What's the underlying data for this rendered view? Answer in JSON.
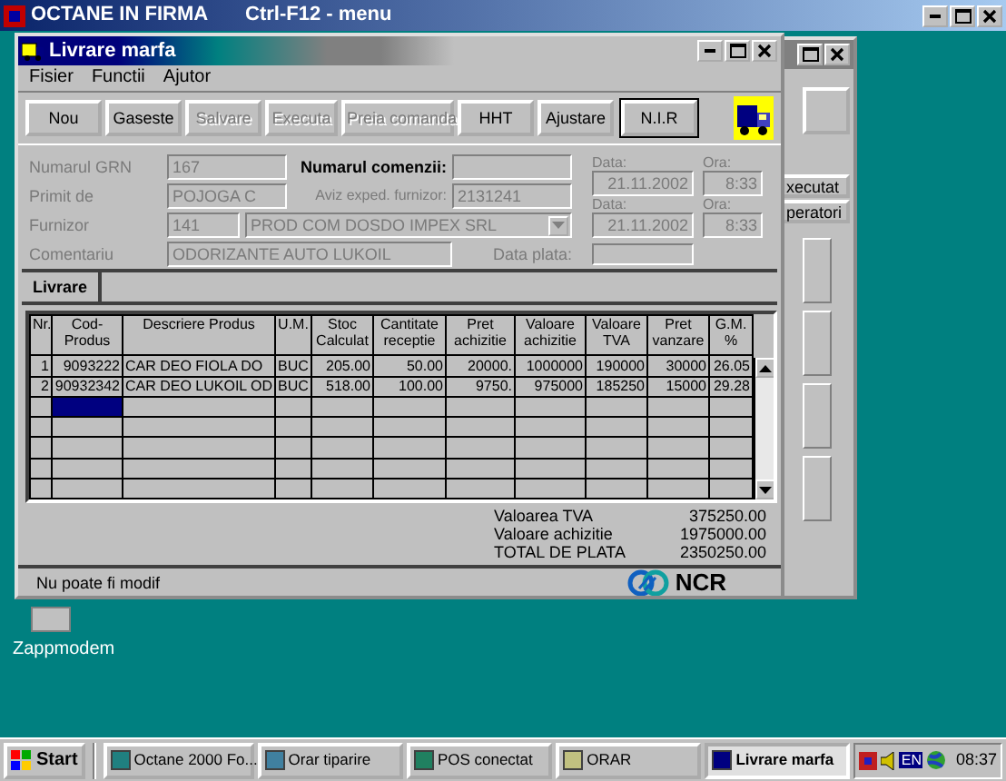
{
  "app_window": {
    "title": "OCTANE IN FIRMA",
    "hint": "Ctrl-F12 - menu"
  },
  "back_window": {
    "buttons": [
      "xecutat",
      "peratori"
    ]
  },
  "window": {
    "title": "Livrare marfa",
    "menu": [
      "Fisier",
      "Functii",
      "Ajutor"
    ],
    "toolbar": [
      {
        "label": "Nou",
        "disabled": false,
        "default": false
      },
      {
        "label": "Gaseste",
        "disabled": false,
        "default": false
      },
      {
        "label": "Salvare",
        "disabled": true,
        "default": false
      },
      {
        "label": "Executa",
        "disabled": true,
        "default": false
      },
      {
        "label": "Preia comanda",
        "disabled": true,
        "default": false
      },
      {
        "label": "HHT",
        "disabled": false,
        "default": false
      },
      {
        "label": "Ajustare",
        "disabled": false,
        "default": false
      },
      {
        "label": "N.I.R",
        "disabled": false,
        "default": true
      }
    ],
    "form": {
      "grn": {
        "label": "Numarul GRN",
        "value": "167",
        "disabled": true
      },
      "primit": {
        "label": "Primit de",
        "value": "POJOGA C",
        "disabled": true
      },
      "furnizor": {
        "label": "Furnizor",
        "code": "141",
        "name": "PROD COM DOSDO IMPEX SRL",
        "disabled": true
      },
      "comentariu": {
        "label": "Comentariu",
        "value": "ODORIZANTE AUTO LUKOIL",
        "disabled": true
      },
      "comanda": {
        "label": "Numarul comenzii:",
        "disabled": false
      },
      "aviz": {
        "label": "Aviz exped. furnizor:",
        "value": "2131241",
        "disabled": true
      },
      "dates": [
        {
          "date_label": "Data:",
          "date": "21.11.2002",
          "time_label": "Ora:",
          "time": "8:33"
        },
        {
          "date_label": "Data:",
          "date": "21.11.2002",
          "time_label": "Ora:",
          "time": "8:33"
        }
      ],
      "data_plata": {
        "label": "Data plata:",
        "disabled": true
      }
    },
    "tabs": [
      {
        "label": "Livrare",
        "selected": true
      }
    ],
    "table": {
      "columns": [
        "Nr.",
        "Cod-Produs",
        "Descriere Produs",
        "U.M.",
        "Stoc Calculat",
        "Cantitate receptie",
        "Pret achizitie",
        "Valoare achizitie",
        "Valoare TVA",
        "Pret vanzare",
        "G.M. %"
      ],
      "rows": [
        [
          "1",
          "9093222",
          "CAR DEO FIOLA DO",
          "BUC",
          "205.00",
          "50.00",
          "20000.",
          "1000000",
          "190000",
          "30000",
          "26.05"
        ],
        [
          "2",
          "90932342",
          "CAR DEO LUKOIL OD",
          "BUC",
          "518.00",
          "100.00",
          "9750.",
          "975000",
          "185250",
          "15000",
          "29.28"
        ]
      ],
      "cursor_on_new_row": true
    },
    "totals": [
      {
        "label": "Valoarea TVA",
        "value": "375250.00"
      },
      {
        "label": "Valoare achizitie",
        "value": "1975000.00"
      },
      {
        "label": "TOTAL DE PLATA",
        "value": "2350250.00"
      }
    ],
    "status": {
      "text": "Nu poate fi modif",
      "logo": "NCR"
    }
  },
  "desktop_icons": [
    {
      "label": "Zappmodem"
    }
  ],
  "taskbar": {
    "start": "Start",
    "items": [
      {
        "label": "Octane 2000 Fo...",
        "selected": false
      },
      {
        "label": "Orar tiparire",
        "selected": false
      },
      {
        "label": "POS conectat",
        "selected": false
      },
      {
        "label": "ORAR",
        "selected": false
      },
      {
        "label": "Livrare marfa",
        "selected": true
      }
    ],
    "language": "EN",
    "clock": "08:37"
  }
}
